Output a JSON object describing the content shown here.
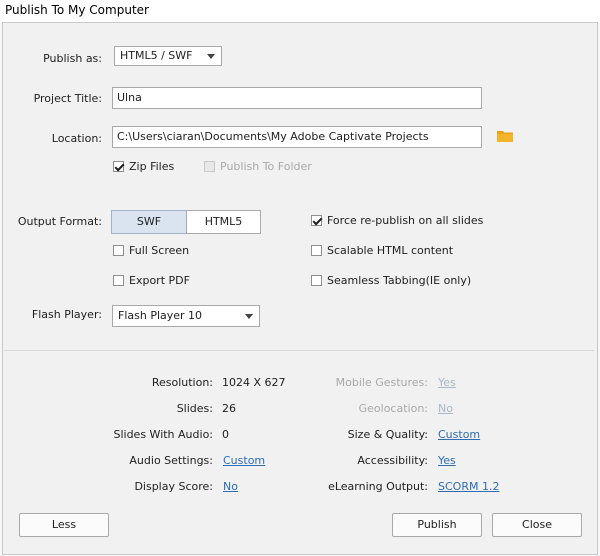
{
  "window": {
    "title": "Publish To My Computer"
  },
  "publish_as": {
    "label": "Publish as:",
    "value": "HTML5 / SWF"
  },
  "project_title": {
    "label": "Project Title:",
    "value": "Ulna"
  },
  "location": {
    "label": "Location:",
    "value": "C:\\Users\\ciaran\\Documents\\My Adobe Captivate Projects",
    "folder_icon": "folder-icon",
    "folder_color": "#e8a317"
  },
  "zip_files": {
    "label": "Zip Files",
    "checked": true
  },
  "publish_to_folder": {
    "label": "Publish To Folder",
    "checked": false,
    "enabled": false
  },
  "output_format": {
    "label": "Output Format:",
    "options": [
      "SWF",
      "HTML5"
    ],
    "selected": "SWF"
  },
  "checkboxes": {
    "force_republish": {
      "label": "Force re-publish on all slides",
      "checked": true
    },
    "full_screen": {
      "label": "Full Screen",
      "checked": false
    },
    "scalable_html": {
      "label": "Scalable HTML content",
      "checked": false
    },
    "export_pdf": {
      "label": "Export PDF",
      "checked": false
    },
    "seamless_tabbing": {
      "label": "Seamless Tabbing(IE only)",
      "checked": false
    }
  },
  "flash_player": {
    "label": "Flash Player:",
    "value": "Flash Player 10"
  },
  "info": {
    "resolution": {
      "label": "Resolution:",
      "value": "1024 X 627"
    },
    "slides": {
      "label": "Slides:",
      "value": "26"
    },
    "slides_with_audio": {
      "label": "Slides With Audio:",
      "value": "0"
    },
    "audio_settings": {
      "label": "Audio Settings:",
      "value": "Custom"
    },
    "display_score": {
      "label": "Display Score:",
      "value": "No"
    },
    "mobile_gestures": {
      "label": "Mobile Gestures:",
      "value": "Yes"
    },
    "geolocation": {
      "label": "Geolocation:",
      "value": "No"
    },
    "size_quality": {
      "label": "Size & Quality:",
      "value": "Custom"
    },
    "accessibility": {
      "label": "Accessibility:",
      "value": "Yes"
    },
    "elearning_output": {
      "label": "eLearning Output:",
      "value": "SCORM 1.2"
    }
  },
  "buttons": {
    "less": "Less",
    "publish": "Publish",
    "close": "Close"
  },
  "colors": {
    "link": "#2e6db4",
    "disabled_text": "#a9a9a9",
    "active_segment": "#d9e4f0"
  }
}
